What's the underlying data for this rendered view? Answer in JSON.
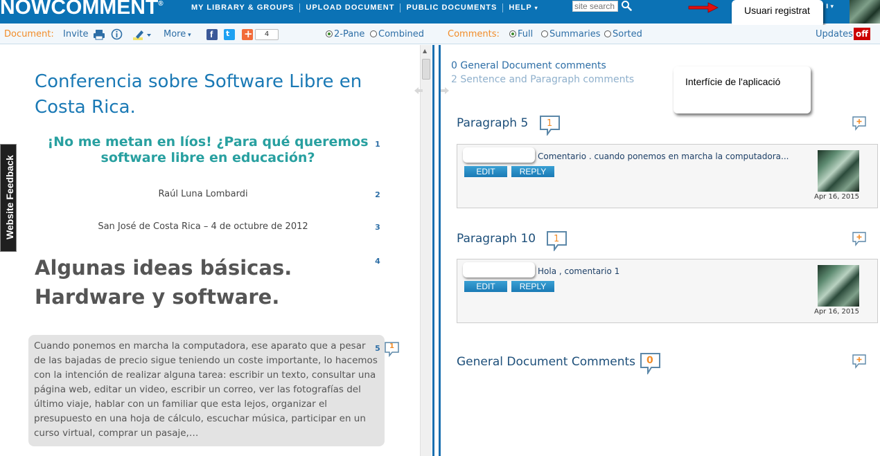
{
  "header": {
    "logo": "NOWCOMMENT",
    "logo_mark": "®",
    "nav": [
      {
        "label": "MY LIBRARY & GROUPS",
        "caret": ""
      },
      {
        "label": "UPLOAD DOCUMENT",
        "caret": ""
      },
      {
        "label": "PUBLIC DOCUMENTS",
        "caret": ""
      },
      {
        "label": "HELP",
        "caret": "▾"
      }
    ],
    "search_placeholder": "site search",
    "user_menu_caret": "I ▾"
  },
  "annotations": {
    "user_callout": "Usuari registrat",
    "interface_callout": "Interfície de l'aplicació"
  },
  "toolbar": {
    "document_label": "Document:",
    "invite": "Invite",
    "more": "More",
    "share_count": "4",
    "two_pane": "2-Pane",
    "combined": "Combined",
    "comments_label": "Comments:",
    "full": "Full",
    "summaries": "Summaries",
    "sorted": "Sorted",
    "updates": "Updates",
    "updates_toggle": "off"
  },
  "feedback_tab": "Website Feedback",
  "document": {
    "title": "Conferencia sobre Software Libre en Costa Rica.",
    "subtitle": "¡No me metan en líos! ¿Para qué queremos software libre en educación?",
    "author": "Raúl Luna Lombardi",
    "place_date": "San José de Costa Rica – 4 de octubre de 2012",
    "heading": "Algunas ideas básicas. Hardware y software.",
    "paragraph5": "Cuando ponemos en marcha la computadora, ese aparato que a pesar de las bajadas de precio sigue teniendo un coste importante, lo hacemos con la intención de realizar alguna tarea: escribir un texto, consultar una página web, editar un video, escribir un correo, ver las fotografías del último viaje, hablar con un familiar que esta lejos, organizar el presupuesto en una hoja de cálculo, escuchar música, participar en un curso virtual, comprar un pasaje,…",
    "numbers": [
      "1",
      "2",
      "3",
      "4",
      "5"
    ],
    "para5_count": "1"
  },
  "comments": {
    "general_count_line": "0 General Document comments",
    "sentence_count_line": "2 Sentence and Paragraph comments",
    "sections": [
      {
        "title": "Paragraph 5",
        "count": "1",
        "text": "Comentario . cuando ponemos en marcha la computadora...",
        "edit": "EDIT",
        "reply": "REPLY",
        "date": "Apr 16, 2015"
      },
      {
        "title": "Paragraph 10",
        "count": "1",
        "text": "Hola , comentario 1",
        "edit": "EDIT",
        "reply": "REPLY",
        "date": "Apr 16, 2015"
      }
    ],
    "general_title": "General Document Comments",
    "general_count": "0"
  },
  "colors": {
    "topbar": "#0b72b5",
    "accent_orange": "#f28c28",
    "link_blue": "#2d6ea6",
    "teal": "#28a0a0",
    "updates_off": "#cc0000"
  }
}
